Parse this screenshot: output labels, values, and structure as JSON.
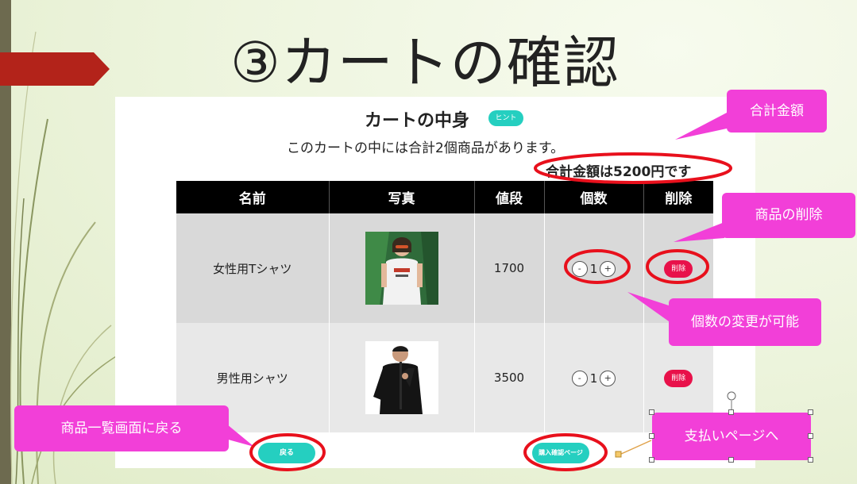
{
  "slide": {
    "title": "③カートの確認"
  },
  "cart": {
    "heading": "カートの中身",
    "hint_label": "ヒント",
    "description": "このカートの中には合計2個商品があります。",
    "total_text": "合計金額は5200円です",
    "columns": [
      "名前",
      "写真",
      "値段",
      "個数",
      "削除"
    ],
    "items": [
      {
        "name": "女性用Tシャツ",
        "price": "1700",
        "qty": "1",
        "minus": "-",
        "plus": "+",
        "delete_label": "削除"
      },
      {
        "name": "男性用シャツ",
        "price": "3500",
        "qty": "1",
        "minus": "-",
        "plus": "+",
        "delete_label": "削除"
      }
    ],
    "back_label": "戻る",
    "confirm_label": "購入確認ページ"
  },
  "callouts": {
    "total": "合計金額",
    "delete": "商品の削除",
    "quantity": "個数の変更が可能",
    "back": "商品一覧画面に戻る",
    "payment": "支払いページへ"
  },
  "colors": {
    "accent": "#25cfc0",
    "delete": "#e8114a",
    "callout": "#f23fd8",
    "highlight_ring": "#e8101c",
    "title_arrow": "#b3231a"
  }
}
